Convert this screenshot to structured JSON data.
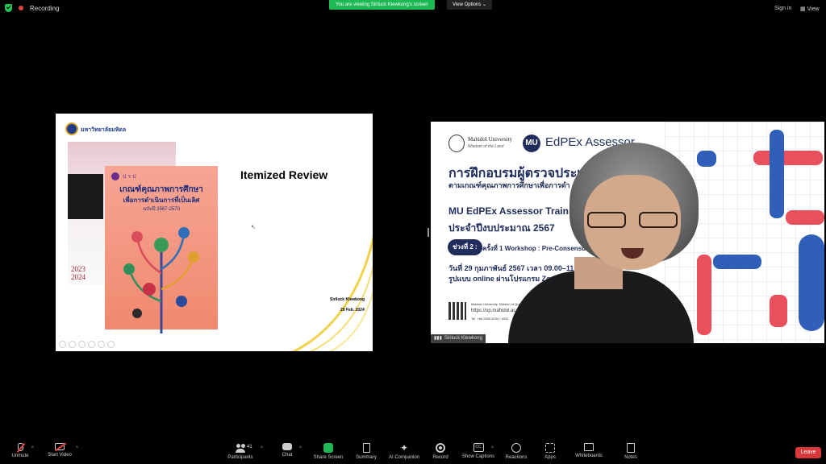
{
  "topbar": {
    "recording_label": "Recording",
    "banner": "You are viewing Siriluck Klewkong's screen",
    "view_options": "View Options",
    "sign_in": "Sign in",
    "view": "View"
  },
  "slide": {
    "university_name": "มหาวิทยาลัยมหิดล",
    "book_front_logo_text": "ป ร ป",
    "book_front_title": "เกณฑ์คุณภาพการศึกษา",
    "book_front_subtitle": "เพื่อการดำเนินการที่เป็นเลิศ",
    "book_front_year": "ฉบับปี 2567-2570",
    "book_back_year": "2023\n2024",
    "title": "Itemized Review",
    "author": "Siriluck Klewkong",
    "date": "29 Feb. 2024"
  },
  "webcam": {
    "mu_name": "Mahidol University",
    "mu_tagline": "Wisdom of the Land",
    "edpex_logo": "MU",
    "edpex_title": "EdPEx Assessor",
    "heading_th": "การฝึกอบรมผู้ตรวจประเมิน",
    "subheading_th": "ตามเกณฑ์คุณภาพการศึกษาเพื่อการดำ",
    "heading_en": "MU EdPEx Assessor Training",
    "fiscal_year": "ประจำปีงบประมาณ 2567",
    "session_pill": "ช่วงที่ 2 :",
    "workshop": "ครั้งที่ 1 Workshop : Pre-Consensus",
    "date_time": "วันที่ 29 กุมภาพันธ์ 2567 เวลา 09.00–11.00 น.",
    "mode": "รูปแบบ online ผ่านโปรแกรม Zoom Meeting",
    "footer_org": "Mahidol University, Division of Quality",
    "footer_url": "https://op.mahidol.ac.th",
    "footer_tel": "Tel. +66 2849 6034 / 6032",
    "participant_name": "Siriluck Klewkong"
  },
  "toolbar": {
    "unmute": "Unmute",
    "start_video": "Start Video",
    "participants": "Participants",
    "participants_count": "41",
    "chat": "Chat",
    "share_screen": "Share Screen",
    "summary": "Summary",
    "ai_companion": "AI Companion",
    "record": "Record",
    "show_captions": "Show Captions",
    "reactions": "Reactions",
    "apps": "Apps",
    "whiteboards": "Whiteboards",
    "notes": "Notes",
    "leave": "Leave"
  },
  "colors": {
    "banner_green": "#1db954",
    "leave_red": "#d93838",
    "edpex_navy": "#1f2c5c",
    "deco_red": "#e8505b",
    "deco_blue": "#2f5fb8"
  }
}
